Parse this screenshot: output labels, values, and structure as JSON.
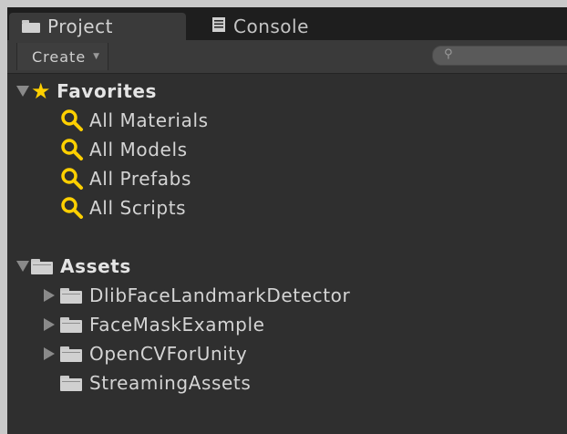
{
  "tabs": [
    {
      "label": "Project",
      "icon": "folder-icon",
      "active": true
    },
    {
      "label": "Console",
      "icon": "console-icon",
      "active": false
    }
  ],
  "toolbar": {
    "create_label": "Create",
    "search_placeholder": ""
  },
  "favorites": {
    "label": "Favorites",
    "items": [
      {
        "label": "All Materials",
        "icon": "search-icon"
      },
      {
        "label": "All Models",
        "icon": "search-icon"
      },
      {
        "label": "All Prefabs",
        "icon": "search-icon"
      },
      {
        "label": "All Scripts",
        "icon": "search-icon"
      }
    ]
  },
  "assets": {
    "label": "Assets",
    "items": [
      {
        "label": "DlibFaceLandmarkDetector",
        "expandable": true
      },
      {
        "label": "FaceMaskExample",
        "expandable": true
      },
      {
        "label": "OpenCVForUnity",
        "expandable": true
      },
      {
        "label": "StreamingAssets",
        "expandable": false
      }
    ]
  },
  "colors": {
    "panel_bg": "#2f2f2f",
    "tabbar_bg": "#1e1e1e",
    "text": "#d4d4d4",
    "favorite_accent": "#ffd000"
  }
}
